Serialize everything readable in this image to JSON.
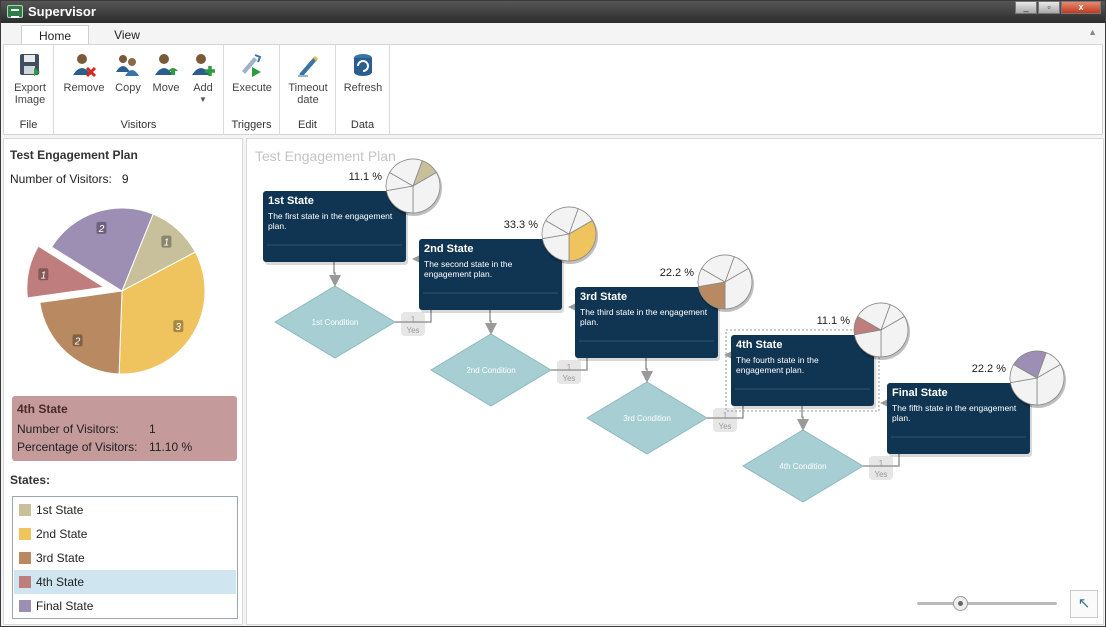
{
  "window": {
    "title": "Supervisor",
    "min": "_",
    "max": "▫",
    "close": "x"
  },
  "tabs": [
    {
      "label": "Home"
    },
    {
      "label": "View"
    }
  ],
  "ribbon": {
    "groups": [
      {
        "title": "File",
        "buttons": [
          {
            "label": "Export Image",
            "icon": "save-image-icon"
          }
        ]
      },
      {
        "title": "Visitors",
        "buttons": [
          {
            "label": "Remove",
            "icon": "remove-user-icon"
          },
          {
            "label": "Copy",
            "icon": "copy-users-icon"
          },
          {
            "label": "Move",
            "icon": "move-user-icon"
          },
          {
            "label": "Add",
            "icon": "add-user-icon"
          }
        ]
      },
      {
        "title": "Triggers",
        "buttons": [
          {
            "label": "Execute",
            "icon": "execute-icon"
          }
        ]
      },
      {
        "title": "Edit",
        "buttons": [
          {
            "label": "Timeout date",
            "icon": "timeout-edit-icon"
          }
        ]
      },
      {
        "title": "Data",
        "buttons": [
          {
            "label": "Refresh",
            "icon": "refresh-icon"
          }
        ]
      }
    ]
  },
  "left": {
    "plan_title": "Test Engagement Plan",
    "visitors_label": "Number of Visitors:",
    "visitors_value": "9",
    "pie": {
      "slices": [
        {
          "state": "1st State",
          "count": 1,
          "label": "1",
          "color": "#c8c09a"
        },
        {
          "state": "2nd State",
          "count": 3,
          "label": "3",
          "color": "#efc45e"
        },
        {
          "state": "3rd State",
          "count": 2,
          "label": "2",
          "color": "#b98a61"
        },
        {
          "state": "4th State",
          "count": 1,
          "label": "1",
          "color": "#bf7d7d",
          "exploded": true
        },
        {
          "state": "Final State",
          "count": 2,
          "label": "2",
          "color": "#9c8fb3"
        }
      ]
    },
    "info": {
      "title": "4th State",
      "visitors_label": "Number of Visitors:",
      "visitors_value": "1",
      "percent_label": "Percentage of Visitors:",
      "percent_value": "11.10 %"
    },
    "states_label": "States:",
    "legend": [
      {
        "label": "1st State",
        "color": "#c8c09a",
        "selected": false
      },
      {
        "label": "2nd State",
        "color": "#efc45e",
        "selected": false
      },
      {
        "label": "3rd State",
        "color": "#b98a61",
        "selected": false
      },
      {
        "label": "4th State",
        "color": "#bf7d7d",
        "selected": true
      },
      {
        "label": "Final State",
        "color": "#9c8fb3",
        "selected": false
      }
    ]
  },
  "canvas": {
    "title": "Test Engagement Plan",
    "states": [
      {
        "title": "1st State",
        "desc": [
          "The first state in the engagement",
          "plan."
        ],
        "percent": "11.1 %",
        "highlight": 0,
        "color": "#c8c09a"
      },
      {
        "title": "2nd State",
        "desc": [
          "The second state in the",
          "engagement plan."
        ],
        "percent": "33.3 %",
        "highlight": 1,
        "color": "#efc45e"
      },
      {
        "title": "3rd State",
        "desc": [
          "The third state in the engagement",
          "plan."
        ],
        "percent": "22.2 %",
        "highlight": 2,
        "color": "#b98a61"
      },
      {
        "title": "4th State",
        "desc": [
          "The fourth state in the",
          "engagement plan."
        ],
        "percent": "11.1 %",
        "highlight": 3,
        "color": "#bf7d7d"
      },
      {
        "title": "Final State",
        "desc": [
          "The fifth state in the engagement",
          "plan."
        ],
        "percent": "22.2 %",
        "highlight": 4,
        "color": "#9c8fb3"
      }
    ],
    "conditions": [
      {
        "label": "1st Condition",
        "count": "1",
        "branch": "Yes"
      },
      {
        "label": "2nd Condition",
        "count": "1",
        "branch": "Yes"
      },
      {
        "label": "3rd Condition",
        "count": "1",
        "branch": "Yes"
      },
      {
        "label": "4th Condition",
        "count": "1",
        "branch": "Yes"
      }
    ],
    "fit_icon": "↖"
  }
}
